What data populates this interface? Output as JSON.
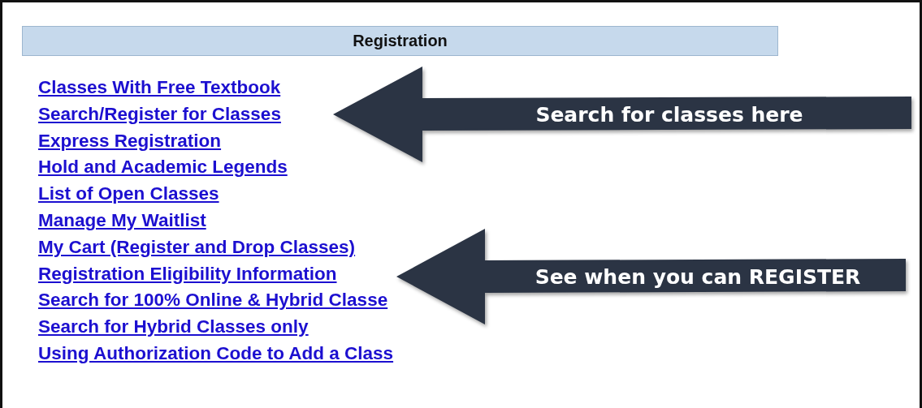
{
  "panel": {
    "title": "Registration"
  },
  "links": [
    "Classes With Free Textbook",
    "Search/Register for Classes",
    "Express Registration",
    "Hold and Academic Legends",
    "List of Open Classes",
    "Manage My Waitlist",
    "My Cart (Register and Drop Classes)",
    "Registration Eligibility Information",
    "Search for 100% Online & Hybrid Classe",
    "Search for Hybrid Classes only",
    "Using Authorization Code to Add a Class"
  ],
  "callouts": [
    {
      "text": "Search for classes here"
    },
    {
      "text": "See when you can REGISTER"
    }
  ]
}
